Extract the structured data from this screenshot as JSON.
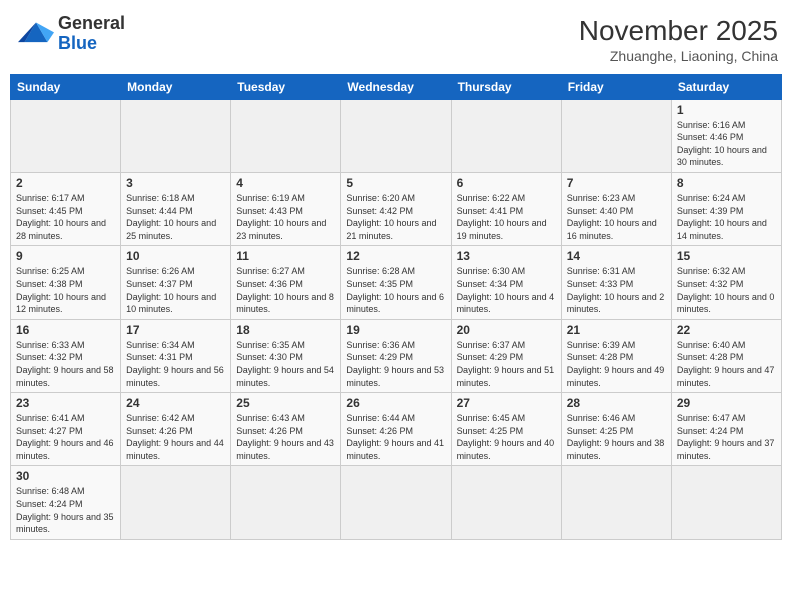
{
  "logo": {
    "line1": "General",
    "line2": "Blue"
  },
  "title": "November 2025",
  "subtitle": "Zhuanghe, Liaoning, China",
  "weekdays": [
    "Sunday",
    "Monday",
    "Tuesday",
    "Wednesday",
    "Thursday",
    "Friday",
    "Saturday"
  ],
  "weeks": [
    [
      {
        "day": "",
        "info": ""
      },
      {
        "day": "",
        "info": ""
      },
      {
        "day": "",
        "info": ""
      },
      {
        "day": "",
        "info": ""
      },
      {
        "day": "",
        "info": ""
      },
      {
        "day": "",
        "info": ""
      },
      {
        "day": "1",
        "info": "Sunrise: 6:16 AM\nSunset: 4:46 PM\nDaylight: 10 hours\nand 30 minutes."
      }
    ],
    [
      {
        "day": "2",
        "info": "Sunrise: 6:17 AM\nSunset: 4:45 PM\nDaylight: 10 hours\nand 28 minutes."
      },
      {
        "day": "3",
        "info": "Sunrise: 6:18 AM\nSunset: 4:44 PM\nDaylight: 10 hours\nand 25 minutes."
      },
      {
        "day": "4",
        "info": "Sunrise: 6:19 AM\nSunset: 4:43 PM\nDaylight: 10 hours\nand 23 minutes."
      },
      {
        "day": "5",
        "info": "Sunrise: 6:20 AM\nSunset: 4:42 PM\nDaylight: 10 hours\nand 21 minutes."
      },
      {
        "day": "6",
        "info": "Sunrise: 6:22 AM\nSunset: 4:41 PM\nDaylight: 10 hours\nand 19 minutes."
      },
      {
        "day": "7",
        "info": "Sunrise: 6:23 AM\nSunset: 4:40 PM\nDaylight: 10 hours\nand 16 minutes."
      },
      {
        "day": "8",
        "info": "Sunrise: 6:24 AM\nSunset: 4:39 PM\nDaylight: 10 hours\nand 14 minutes."
      }
    ],
    [
      {
        "day": "9",
        "info": "Sunrise: 6:25 AM\nSunset: 4:38 PM\nDaylight: 10 hours\nand 12 minutes."
      },
      {
        "day": "10",
        "info": "Sunrise: 6:26 AM\nSunset: 4:37 PM\nDaylight: 10 hours\nand 10 minutes."
      },
      {
        "day": "11",
        "info": "Sunrise: 6:27 AM\nSunset: 4:36 PM\nDaylight: 10 hours\nand 8 minutes."
      },
      {
        "day": "12",
        "info": "Sunrise: 6:28 AM\nSunset: 4:35 PM\nDaylight: 10 hours\nand 6 minutes."
      },
      {
        "day": "13",
        "info": "Sunrise: 6:30 AM\nSunset: 4:34 PM\nDaylight: 10 hours\nand 4 minutes."
      },
      {
        "day": "14",
        "info": "Sunrise: 6:31 AM\nSunset: 4:33 PM\nDaylight: 10 hours\nand 2 minutes."
      },
      {
        "day": "15",
        "info": "Sunrise: 6:32 AM\nSunset: 4:32 PM\nDaylight: 10 hours\nand 0 minutes."
      }
    ],
    [
      {
        "day": "16",
        "info": "Sunrise: 6:33 AM\nSunset: 4:32 PM\nDaylight: 9 hours\nand 58 minutes."
      },
      {
        "day": "17",
        "info": "Sunrise: 6:34 AM\nSunset: 4:31 PM\nDaylight: 9 hours\nand 56 minutes."
      },
      {
        "day": "18",
        "info": "Sunrise: 6:35 AM\nSunset: 4:30 PM\nDaylight: 9 hours\nand 54 minutes."
      },
      {
        "day": "19",
        "info": "Sunrise: 6:36 AM\nSunset: 4:29 PM\nDaylight: 9 hours\nand 53 minutes."
      },
      {
        "day": "20",
        "info": "Sunrise: 6:37 AM\nSunset: 4:29 PM\nDaylight: 9 hours\nand 51 minutes."
      },
      {
        "day": "21",
        "info": "Sunrise: 6:39 AM\nSunset: 4:28 PM\nDaylight: 9 hours\nand 49 minutes."
      },
      {
        "day": "22",
        "info": "Sunrise: 6:40 AM\nSunset: 4:28 PM\nDaylight: 9 hours\nand 47 minutes."
      }
    ],
    [
      {
        "day": "23",
        "info": "Sunrise: 6:41 AM\nSunset: 4:27 PM\nDaylight: 9 hours\nand 46 minutes."
      },
      {
        "day": "24",
        "info": "Sunrise: 6:42 AM\nSunset: 4:26 PM\nDaylight: 9 hours\nand 44 minutes."
      },
      {
        "day": "25",
        "info": "Sunrise: 6:43 AM\nSunset: 4:26 PM\nDaylight: 9 hours\nand 43 minutes."
      },
      {
        "day": "26",
        "info": "Sunrise: 6:44 AM\nSunset: 4:26 PM\nDaylight: 9 hours\nand 41 minutes."
      },
      {
        "day": "27",
        "info": "Sunrise: 6:45 AM\nSunset: 4:25 PM\nDaylight: 9 hours\nand 40 minutes."
      },
      {
        "day": "28",
        "info": "Sunrise: 6:46 AM\nSunset: 4:25 PM\nDaylight: 9 hours\nand 38 minutes."
      },
      {
        "day": "29",
        "info": "Sunrise: 6:47 AM\nSunset: 4:24 PM\nDaylight: 9 hours\nand 37 minutes."
      }
    ],
    [
      {
        "day": "30",
        "info": "Sunrise: 6:48 AM\nSunset: 4:24 PM\nDaylight: 9 hours\nand 35 minutes."
      },
      {
        "day": "",
        "info": ""
      },
      {
        "day": "",
        "info": ""
      },
      {
        "day": "",
        "info": ""
      },
      {
        "day": "",
        "info": ""
      },
      {
        "day": "",
        "info": ""
      },
      {
        "day": "",
        "info": ""
      }
    ]
  ]
}
